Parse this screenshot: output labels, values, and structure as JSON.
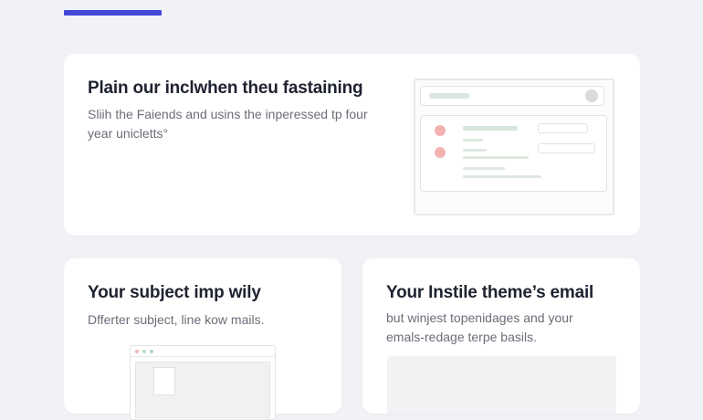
{
  "colors": {
    "accent": "#4347d9",
    "background": "#f1f2f6",
    "card": "#ffffff",
    "title_text": "#1f2230",
    "body_text": "#6b6e78"
  },
  "top_card": {
    "title": "Plain our inclwhen theu fastaining",
    "description": "Sliih the Faiends and usins the inperessed tp four year unicletts°"
  },
  "left_card": {
    "title": "Your subject imp wily",
    "description": "Dfferter subject, line kow mails."
  },
  "right_card": {
    "title": "Your Instile theme’s email",
    "description": "but winjest topenidages and your emals-redage terpe basils."
  }
}
